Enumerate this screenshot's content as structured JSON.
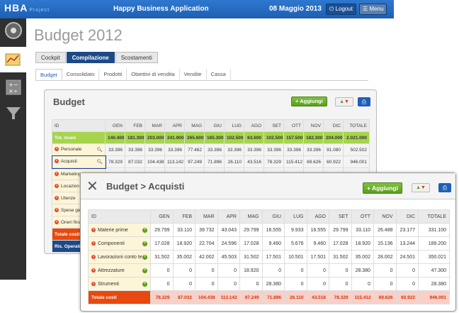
{
  "topbar": {
    "logo": "HBA",
    "logo_sub": "Project",
    "title": "Happy Business Application",
    "date": "08 Maggio 2013",
    "logout": "Logout",
    "menu": "Menu"
  },
  "sidebar": {
    "icons": [
      "palette-icon",
      "chart-icon",
      "calculator-icon",
      "funnel-icon"
    ]
  },
  "page": {
    "title": "Budget 2012"
  },
  "tabs": [
    "Cockpit",
    "Compilazione",
    "Scostamenti"
  ],
  "subtabs": [
    "Budget",
    "Consolidato",
    "Prodotti",
    "Obiettivi di vendita",
    "Vendite",
    "Cassa"
  ],
  "panel1": {
    "title": "Budget",
    "add_label": "Aggiungi",
    "columns": [
      "ID",
      "GEN",
      "FEB",
      "MAR",
      "APR",
      "MAG",
      "GIU",
      "LUG",
      "AGO",
      "SET",
      "OTT",
      "NOV",
      "DIC",
      "TOTALE"
    ],
    "total_row": {
      "label": "Tot. ricavi",
      "values": [
        "140.400",
        "181.300",
        "203.000",
        "241.900",
        "265.600",
        "165.300",
        "102.500",
        "63.600",
        "102.500",
        "157.500",
        "182.300",
        "204.000",
        "168.600",
        "2.021.000"
      ]
    },
    "rows": [
      {
        "label": "Personale",
        "values": [
          "33.396",
          "33.396",
          "33.396",
          "33.396",
          "77.462",
          "33.396",
          "33.396",
          "33.396",
          "33.396",
          "33.396",
          "33.396",
          "91.080",
          "",
          "502.502"
        ]
      },
      {
        "label": "Acquisti",
        "values": [
          "78.329",
          "87.032",
          "104.438",
          "113.142",
          "97.249",
          "71.896",
          "26.110",
          "43.516",
          "78.329",
          "115.412",
          "69.626",
          "60.922",
          "",
          "946.001"
        ]
      },
      {
        "label": "Marketing",
        "values": [
          "",
          "",
          "",
          "",
          "",
          "",
          "",
          "",
          "",
          "",
          "",
          "",
          "",
          ""
        ]
      },
      {
        "label": "Locazion",
        "values": [
          "",
          "",
          "",
          "",
          "",
          "",
          "",
          "",
          "",
          "",
          "",
          "",
          "",
          ""
        ]
      },
      {
        "label": "Utenze",
        "values": [
          "",
          "",
          "",
          "",
          "",
          "",
          "",
          "",
          "",
          "",
          "",
          "",
          "",
          ""
        ]
      },
      {
        "label": "Spese ge",
        "values": [
          "",
          "",
          "",
          "",
          "",
          "",
          "",
          "",
          "",
          "",
          "",
          "",
          "",
          ""
        ]
      },
      {
        "label": "Oneri fina",
        "values": [
          "",
          "",
          "",
          "",
          "",
          "",
          "",
          "",
          "",
          "",
          "",
          "",
          "",
          ""
        ]
      }
    ],
    "totale_costi": "Totale costi",
    "ris_operativo": "Ris. Operati"
  },
  "panel2": {
    "title": "Budget > Acquisti",
    "add_label": "Aggiungi",
    "columns": [
      "ID",
      "GEN",
      "FEB",
      "MAR",
      "APR",
      "MAG",
      "GIU",
      "LUG",
      "AGO",
      "SET",
      "OTT",
      "NOV",
      "DIC",
      "TOTALE"
    ],
    "rows": [
      {
        "label": "Materie prime",
        "values": [
          "29.799",
          "33.110",
          "39.732",
          "43.043",
          "29.799",
          "16.555",
          "9.933",
          "16.555",
          "29.799",
          "33.110",
          "26.488",
          "23.177",
          "331.100"
        ]
      },
      {
        "label": "Componenti",
        "values": [
          "17.028",
          "18.920",
          "22.704",
          "24.596",
          "17.028",
          "9.460",
          "5.676",
          "9.460",
          "17.028",
          "18.920",
          "15.136",
          "13.244",
          "189.200"
        ]
      },
      {
        "label": "Lavorazioni conto te",
        "values": [
          "31.502",
          "35.002",
          "42.002",
          "45.503",
          "31.502",
          "17.501",
          "10.501",
          "17.501",
          "31.502",
          "35.002",
          "28.002",
          "24.501",
          "350.021"
        ]
      },
      {
        "label": "Attrezzature",
        "values": [
          "0",
          "0",
          "0",
          "0",
          "18.920",
          "0",
          "0",
          "0",
          "0",
          "28.380",
          "0",
          "0",
          "47.300"
        ]
      },
      {
        "label": "Strumenti",
        "values": [
          "0",
          "0",
          "0",
          "0",
          "0",
          "28.380",
          "0",
          "0",
          "0",
          "0",
          "0",
          "0",
          "28.380"
        ]
      }
    ],
    "total": {
      "label": "Totale costi",
      "values": [
        "78.329",
        "87.032",
        "104.438",
        "113.142",
        "97.249",
        "71.896",
        "26.110",
        "43.516",
        "78.329",
        "115.412",
        "69.626",
        "60.922",
        "946.001"
      ]
    }
  }
}
